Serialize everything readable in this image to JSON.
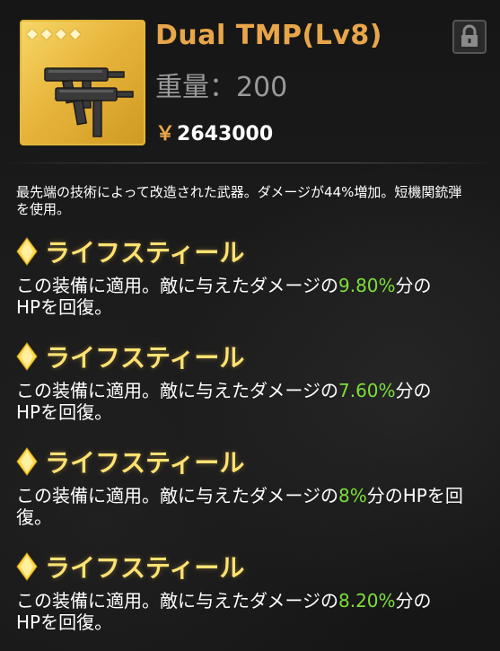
{
  "item": {
    "name": "Dual TMP(Lv8)",
    "weight_label": "重量",
    "weight_sep": "：",
    "weight_value": "200",
    "currency_symbol": "￥",
    "price": "2643000",
    "star_count": 4,
    "star_glyph": "◆",
    "icon": "smg-weapon-icon",
    "rarity_color": "#e3b73a"
  },
  "lock_icon": "lock-icon",
  "description": "最先端の技術によって改造された武器。ダメージが44%増加。短機関銃弾を使用。",
  "skills": [
    {
      "title": "ライフスティール",
      "desc_pre": "この装備に適用。敵に与えたダメージの",
      "value": "9.80%",
      "desc_post": "分のHPを回復。"
    },
    {
      "title": "ライフスティール",
      "desc_pre": "この装備に適用。敵に与えたダメージの",
      "value": "7.60%",
      "desc_post": "分のHPを回復。"
    },
    {
      "title": "ライフスティール",
      "desc_pre": "この装備に適用。敵に与えたダメージの",
      "value": "8%",
      "desc_post": "分のHPを回復。"
    },
    {
      "title": "ライフスティール",
      "desc_pre": "この装備に適用。敵に与えたダメージの",
      "value": "8.20%",
      "desc_post": "分のHPを回復。"
    }
  ],
  "colors": {
    "name": "#e8a64a",
    "skill_title": "#ffe272",
    "value_highlight": "#7ddf3a",
    "weight": "#9a9a9a"
  }
}
